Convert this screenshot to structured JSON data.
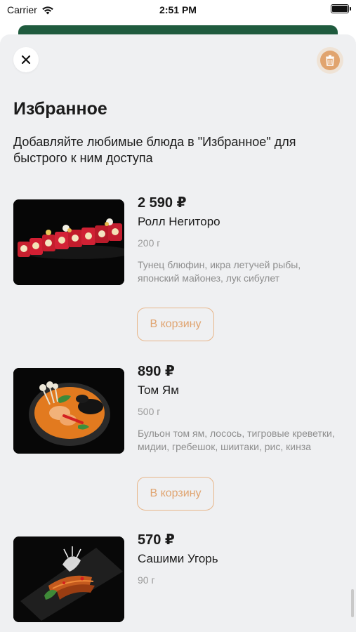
{
  "status": {
    "carrier": "Carrier",
    "time": "2:51 PM"
  },
  "page": {
    "title": "Избранное",
    "subtitle": "Добавляйте любимые блюда в \"Избранное\" для быстрого к ним доступа"
  },
  "items": [
    {
      "price": "2 590 ₽",
      "name": "Ролл Негиторо",
      "weight": "200 г",
      "description": "Тунец блюфин, икра летучей рыбы, японский майонез, лук сибулет",
      "cart_label": "В корзину"
    },
    {
      "price": "890 ₽",
      "name": "Том Ям",
      "weight": "500 г",
      "description": "Бульон том ям, лосось, тигровые креветки, мидии, гребешок, шиитаки, рис, кинза",
      "cart_label": "В корзину"
    },
    {
      "price": "570 ₽",
      "name": "Сашими Угорь",
      "weight": "90 г"
    }
  ],
  "icons": {
    "close": "close-icon",
    "trash": "trash-icon",
    "wifi": "wifi-icon",
    "battery": "battery-icon"
  },
  "colors": {
    "accent": "#e0a470",
    "header_strip": "#1f5b3e",
    "sheet_bg": "#eff0f2"
  }
}
